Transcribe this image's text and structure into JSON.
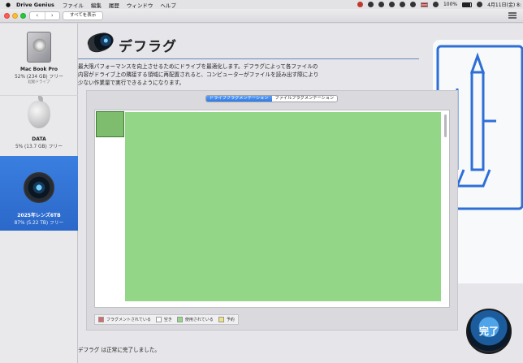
{
  "menubar": {
    "app_name": "Drive Genius",
    "menus": [
      "ファイル",
      "編集",
      "履歴",
      "ウィンドウ",
      "ヘルプ"
    ],
    "battery": "100%",
    "clock": "4月11日(金) 8:"
  },
  "toolbar": {
    "back": "‹",
    "forward": "›",
    "show_all": "すべてを表示"
  },
  "sidebar": {
    "drives": [
      {
        "name": "Mac Book Pro",
        "usage": "52% (234 GB) フリー",
        "sub": "起動ドライブ"
      },
      {
        "name": "DATA",
        "usage": "5% (13.7 GB) フリー"
      },
      {
        "name": "2025年レンズ6TB",
        "usage": "87% (5.22 TB) フリー"
      }
    ]
  },
  "main": {
    "title": "デフラグ",
    "help": "?",
    "description": "最大限パフォーマンスを向上させるためにドライブを最適化します。デフラグによって各ファイルの内容がドライブ上の隣接する領域に再配置されると、コンピューターがファイルを読み出す際により少ない作業量で実行できるようになります。",
    "tabs": [
      "ドライブフラグメンテーション",
      "ファイルフラグメンテーション"
    ],
    "legend": [
      {
        "label": "フラグメントされている",
        "color": "#d9686a"
      },
      {
        "label": "空き",
        "color": "#ffffff"
      },
      {
        "label": "使用されている",
        "color": "#94d687"
      },
      {
        "label": "予約",
        "color": "#f0e27c"
      }
    ],
    "status": "デフラグ は正常に完了しました。",
    "done_label": "完了"
  }
}
